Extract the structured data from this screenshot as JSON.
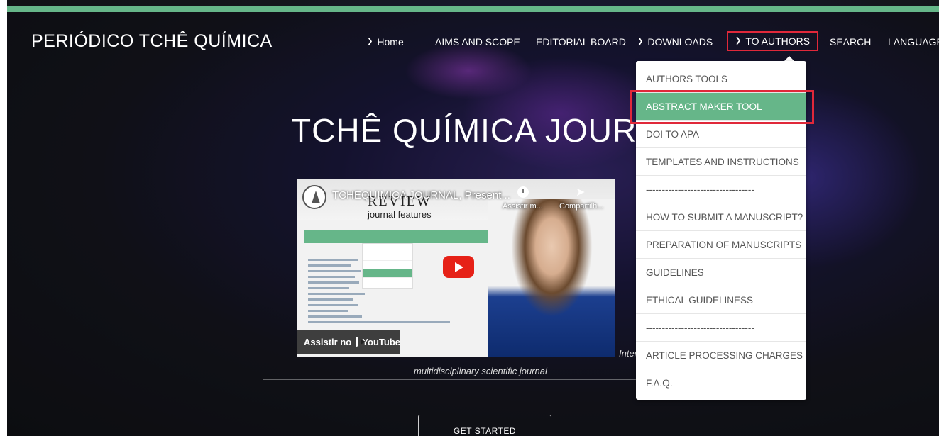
{
  "brand": {
    "title": "PERIÓDICO TCHÊ QUÍMICA"
  },
  "nav": {
    "home": "Home",
    "aims": "AIMS AND SCOPE",
    "board": "EDITORIAL BOARD",
    "downloads": "DOWNLOADS",
    "to_authors": "TO AUTHORS",
    "search": "SEARCH",
    "language": "LANGUAGE"
  },
  "dropdown": {
    "items": [
      "AUTHORS TOOLS",
      "ABSTRACT MAKER TOOL",
      "DOI TO APA",
      "TEMPLATES AND INSTRUCTIONS",
      "----------------------------------",
      "HOW TO SUBMIT A MANUSCRIPT?",
      "PREPARATION OF MANUSCRIPTS",
      "GUIDELINES",
      "ETHICAL GUIDELINESS",
      "----------------------------------",
      "ARTICLE PROCESSING CHARGES",
      "F.A.Q."
    ],
    "active_index": 1
  },
  "hero": {
    "title": "TCHÊ QUÍMICA JOURN",
    "tagline": "multidisciplinary scientific journal",
    "inter": "Inter",
    "cta": "GET STARTED"
  },
  "video": {
    "title": "TCHEQUIMICA JOURNAL, Present...",
    "review": "REVIEW",
    "features": "journal features",
    "watch_later": "Assistir m...",
    "share": "Compartilh...",
    "watch_on": "Assistir no",
    "youtube": "YouTube"
  },
  "colors": {
    "accent": "#66b689",
    "highlight": "#e0283a"
  }
}
